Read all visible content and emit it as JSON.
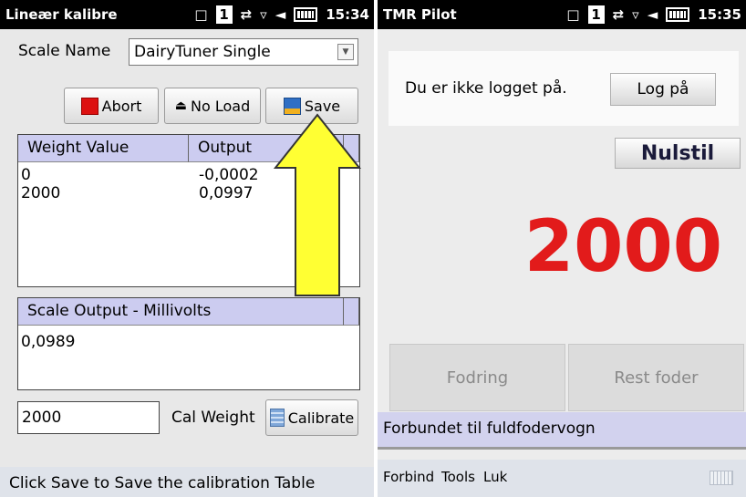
{
  "left": {
    "status": {
      "title": "Lineær kalibre",
      "time": "15:34",
      "badge": "1"
    },
    "scale_name_label": "Scale Name",
    "scale_name_value": "DairyTuner Single",
    "buttons": {
      "abort": "Abort",
      "no_load": "No Load",
      "save": "Save",
      "calibrate": "Calibrate"
    },
    "table": {
      "headers": [
        "Weight Value",
        "Output"
      ],
      "rows": [
        [
          "0",
          "-0,0002"
        ],
        [
          "2000",
          "0,0997"
        ]
      ]
    },
    "output_list": {
      "header": "Scale Output - Millivolts",
      "value": "0,0989"
    },
    "cal_weight_value": "2000",
    "cal_weight_label": "Cal Weight",
    "hint": "Click Save to Save the calibration Table",
    "colors": {
      "arrow_fill": "#ffff33",
      "header_bg": "#ccccf0",
      "abort_red": "#dd1111"
    }
  },
  "right": {
    "status": {
      "title": "TMR Pilot",
      "time": "15:35",
      "badge": "1"
    },
    "login_text": "Du er ikke logget på.",
    "login_button": "Log på",
    "reset_button": "Nulstil",
    "weight": "2000",
    "feed_button": "Fodring",
    "rest_button": "Rest foder",
    "connection_status": "Forbundet til fuldfodervogn",
    "menu": [
      "Forbind",
      "Tools",
      "Luk"
    ],
    "colors": {
      "weight_red": "#e21b1b",
      "status_bar_bg": "#d2d2ee"
    }
  }
}
